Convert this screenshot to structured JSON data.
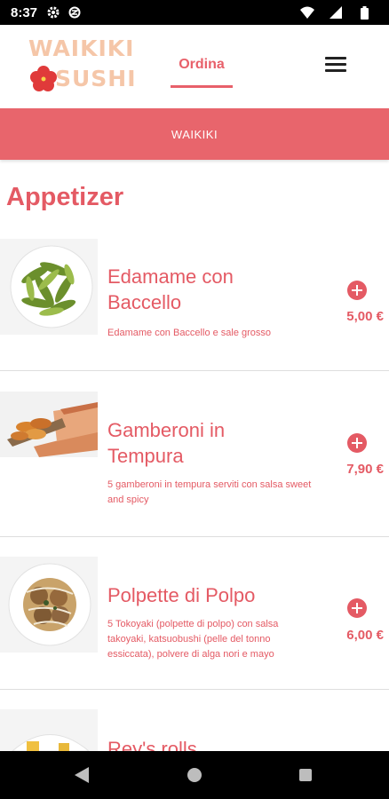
{
  "status_bar": {
    "time": "8:37"
  },
  "header": {
    "logo_line1": "WAIKIKI",
    "logo_line2": "SUSHI",
    "nav_tab": "Ordina"
  },
  "banner": {
    "label": "WAIKIKI"
  },
  "section": {
    "title": "Appetizer"
  },
  "items": [
    {
      "name": "Edamame con Baccello",
      "description": "Edamame con Baccello e sale grosso",
      "price": "5,00 €"
    },
    {
      "name": "Gamberoni in Tempura",
      "description": "5 gamberoni in tempura serviti con salsa sweet and spicy",
      "price": "7,90 €"
    },
    {
      "name": "Polpette di Polpo",
      "description": "5 Tokoyaki (polpette di polpo) con salsa takoyaki, katsuobushi (pelle del tonno essiccata), polvere di alga nori e mayo",
      "price": "6,00 €"
    },
    {
      "name": "Rey's rolls",
      "description": "",
      "price": ""
    }
  ],
  "colors": {
    "accent": "#e45a64",
    "banner": "#e8656c",
    "logo": "#f5c6a8"
  }
}
